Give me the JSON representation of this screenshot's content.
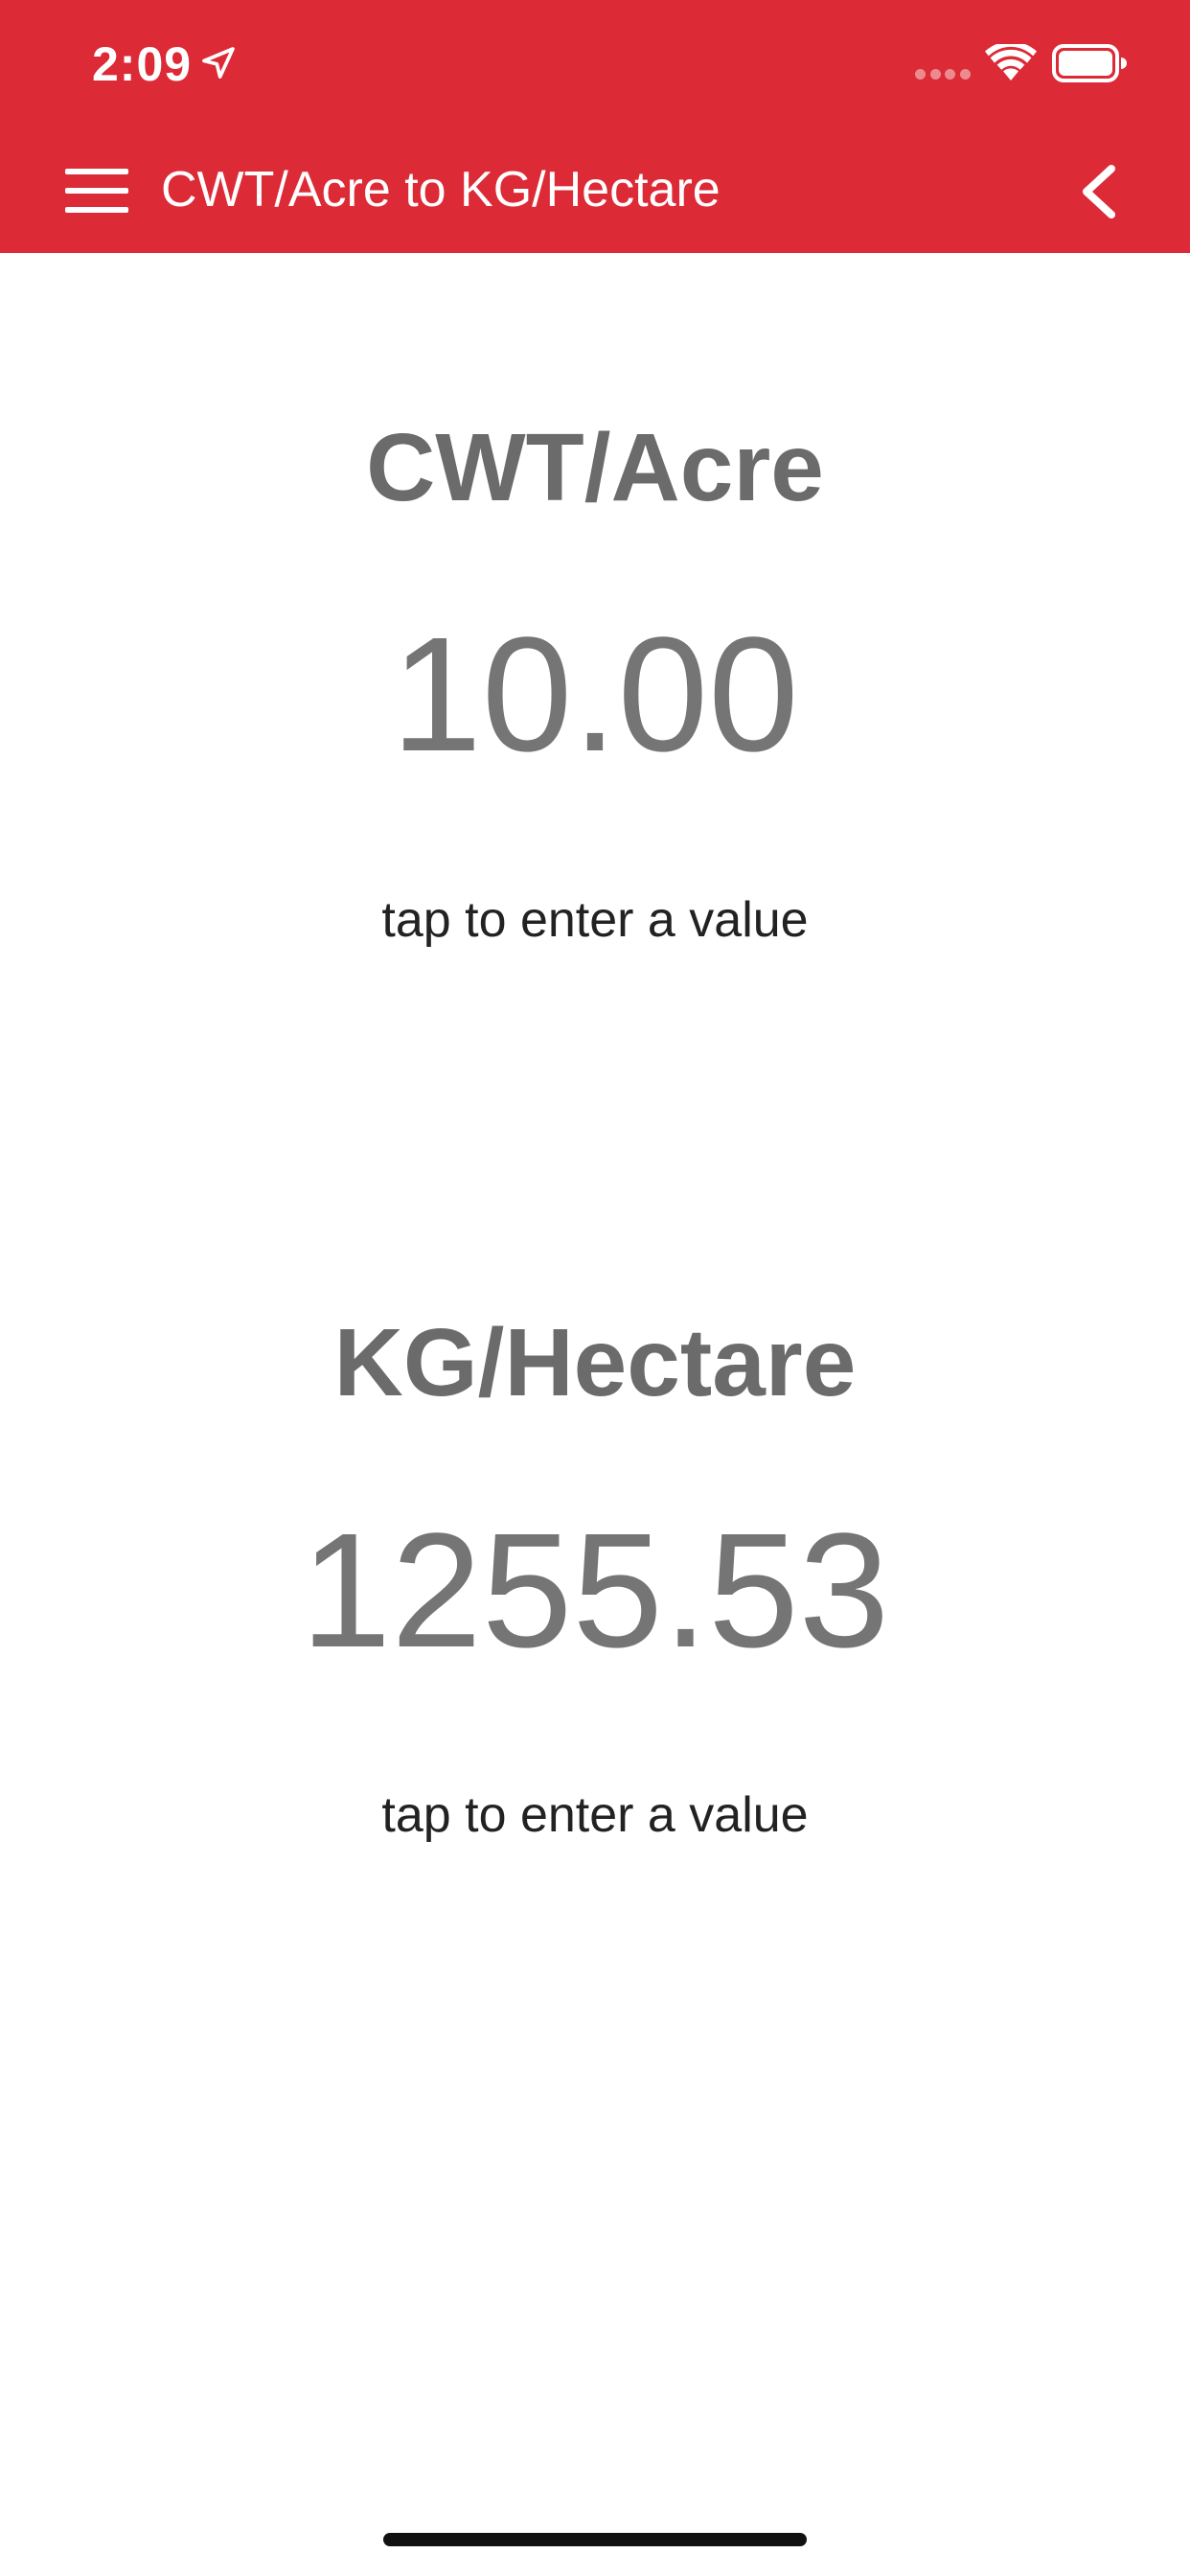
{
  "status_bar": {
    "time": "2:09",
    "location_icon": "location-arrow-icon",
    "wifi_icon": "wifi-icon",
    "battery_icon": "battery-icon"
  },
  "toolbar": {
    "menu_icon": "menu-icon",
    "title": "CWT/Acre to KG/Hectare",
    "back_icon": "chevron-left-icon"
  },
  "converter": {
    "from": {
      "label": "CWT/Acre",
      "value": "10.00",
      "hint": "tap to enter a value"
    },
    "to": {
      "label": "KG/Hectare",
      "value": "1255.53",
      "hint": "tap to enter a value"
    }
  },
  "colors": {
    "accent": "#dc2a36",
    "label": "#6b6b6b",
    "value": "#757575",
    "hint": "#222222"
  }
}
